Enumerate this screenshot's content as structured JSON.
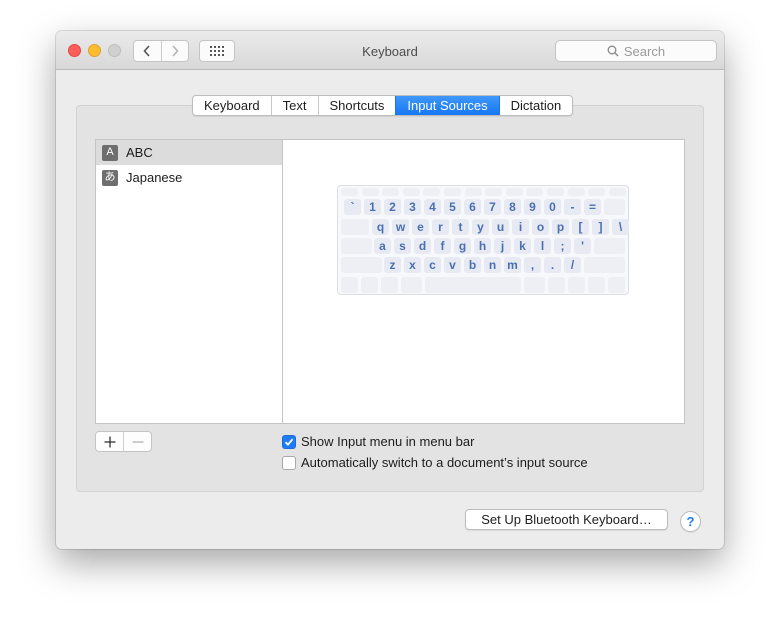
{
  "window": {
    "title": "Keyboard",
    "search_placeholder": "Search"
  },
  "toolbar_icons": [
    "close-button",
    "minimize-button",
    "zoom-button",
    "back-chevron-icon",
    "forward-chevron-icon",
    "show-all-grid-icon",
    "search-icon"
  ],
  "tabs": [
    {
      "label": "Keyboard",
      "active": false
    },
    {
      "label": "Text",
      "active": false
    },
    {
      "label": "Shortcuts",
      "active": false
    },
    {
      "label": "Input Sources",
      "active": true
    },
    {
      "label": "Dictation",
      "active": false
    }
  ],
  "input_sources": [
    {
      "icon_glyph": "A",
      "label": "ABC",
      "selected": true
    },
    {
      "icon_glyph": "あ",
      "label": "Japanese",
      "selected": false
    }
  ],
  "keyboard_rows": [
    [
      "`",
      "1",
      "2",
      "3",
      "4",
      "5",
      "6",
      "7",
      "8",
      "9",
      "0",
      "-",
      "="
    ],
    [
      "q",
      "w",
      "e",
      "r",
      "t",
      "y",
      "u",
      "i",
      "o",
      "p",
      "[",
      "]",
      "\\"
    ],
    [
      "a",
      "s",
      "d",
      "f",
      "g",
      "h",
      "j",
      "k",
      "l",
      ";",
      "'"
    ],
    [
      "z",
      "x",
      "c",
      "v",
      "b",
      "n",
      "m",
      ",",
      ".",
      "/"
    ]
  ],
  "add_remove": {
    "add": "+",
    "remove": "−"
  },
  "options": {
    "show_input_menu": {
      "label": "Show Input menu in menu bar",
      "checked": true
    },
    "auto_switch": {
      "label": "Automatically switch to a document’s input source",
      "checked": false
    }
  },
  "bluetooth_button": "Set Up Bluetooth Keyboard…",
  "help_label": "?",
  "colors": {
    "accent": "#1f7cf5",
    "close": "#fc5f57",
    "minimize": "#fdbc2e",
    "key_text": "#4a6fb3"
  }
}
